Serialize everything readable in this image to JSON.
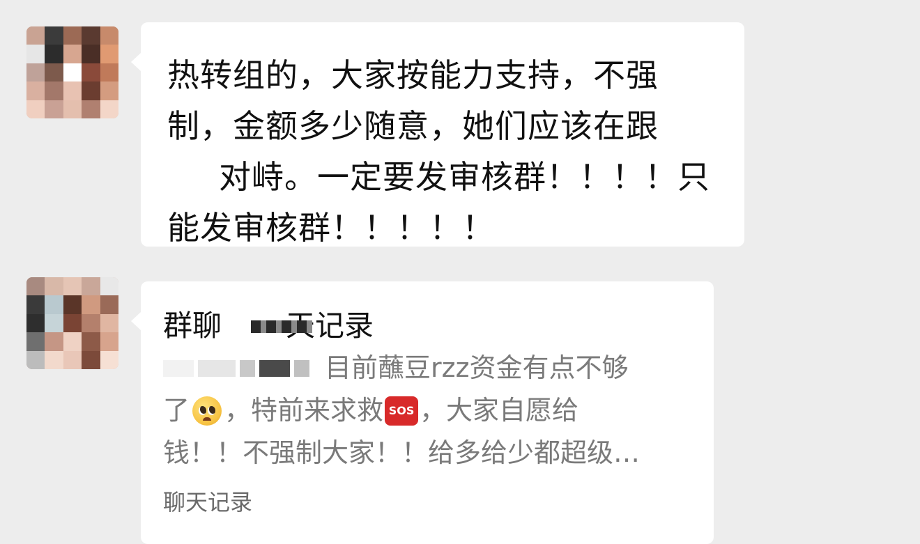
{
  "messages": [
    {
      "type": "text",
      "lines": [
        "热转组的，大家按能力支持，不强",
        "制，金额多少随意，她们应该在跟",
        "对峙。一定要发审核群！！！！只",
        "能发审核群！！！！！"
      ]
    },
    {
      "type": "chat_record",
      "title_left": "群聊",
      "title_right": "天记录",
      "preview_lines": [
        "目前蘸豆rzz资金有点不够",
        [
          "了",
          "，特前来求救",
          "，大家自愿给"
        ],
        "钱！！不强制大家！！给多给少都超级…"
      ],
      "footer": "聊天记录",
      "emoji": {
        "pleading": "pleading-face-icon",
        "sos": "SOS"
      }
    }
  ],
  "colors": {
    "background": "#ededed",
    "bubble": "#ffffff",
    "text": "#111111",
    "preview_text": "#7a7a7a",
    "sos_red": "#d82a2a"
  }
}
